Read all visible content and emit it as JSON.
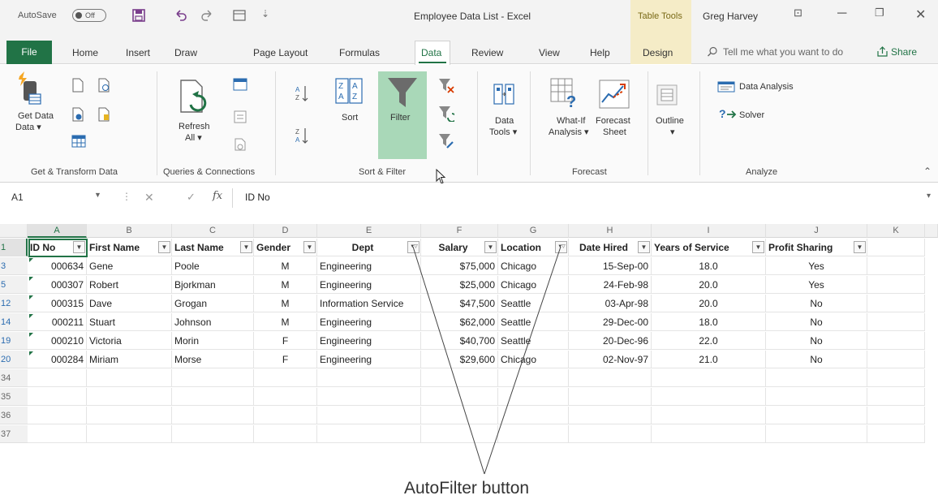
{
  "titlebar": {
    "autosave_label": "AutoSave",
    "autosave_state": "Off",
    "document_title": "Employee Data List  -  Excel",
    "context_tab_group": "Table Tools",
    "user_name": "Greg Harvey"
  },
  "tabs": [
    "File",
    "Home",
    "Insert",
    "Draw",
    "Page Layout",
    "Formulas",
    "Data",
    "Review",
    "View",
    "Help",
    "Design"
  ],
  "active_tab": "Data",
  "tell_me": "Tell me what you want to do",
  "share_label": "Share",
  "ribbon": {
    "get_data": "Get Data",
    "get_data_arrow": "Data ▾",
    "refresh": "Refresh",
    "refresh_all": "All ▾",
    "sort": "Sort",
    "filter": "Filter",
    "data_tools": "Data",
    "data_tools2": "Tools ▾",
    "what_if": "What-If",
    "what_if2": "Analysis ▾",
    "forecast": "Forecast",
    "forecast2": "Sheet",
    "outline": "Outline",
    "outline2": "▾",
    "data_analysis": "Data Analysis",
    "solver": "Solver",
    "groups": {
      "get_transform": "Get & Transform Data",
      "queries": "Queries & Connections",
      "sort_filter": "Sort & Filter",
      "forecast": "Forecast",
      "analyze": "Analyze"
    }
  },
  "formula_bar": {
    "name_box": "A1",
    "content": "ID No"
  },
  "columns": [
    "A",
    "B",
    "C",
    "D",
    "E",
    "F",
    "G",
    "H",
    "I",
    "J",
    "K"
  ],
  "header_row": {
    "row_number": "1",
    "cells": [
      "ID No",
      "First Name",
      "Last Name",
      "Gender",
      "Dept",
      "Salary",
      "Location",
      "Date Hired",
      "Years of Service",
      "Profit Sharing"
    ]
  },
  "rows": [
    {
      "row_number": "3",
      "cells": [
        "000634",
        "Gene",
        "Poole",
        "M",
        "Engineering",
        "$75,000",
        "Chicago",
        "15-Sep-00",
        "18.0",
        "Yes"
      ]
    },
    {
      "row_number": "5",
      "cells": [
        "000307",
        "Robert",
        "Bjorkman",
        "M",
        "Engineering",
        "$25,000",
        "Chicago",
        "24-Feb-98",
        "20.0",
        "Yes"
      ]
    },
    {
      "row_number": "12",
      "cells": [
        "000315",
        "Dave",
        "Grogan",
        "M",
        "Information Service",
        "$47,500",
        "Seattle",
        "03-Apr-98",
        "20.0",
        "No"
      ]
    },
    {
      "row_number": "14",
      "cells": [
        "000211",
        "Stuart",
        "Johnson",
        "M",
        "Engineering",
        "$62,000",
        "Seattle",
        "29-Dec-00",
        "18.0",
        "No"
      ]
    },
    {
      "row_number": "19",
      "cells": [
        "000210",
        "Victoria",
        "Morin",
        "F",
        "Engineering",
        "$40,700",
        "Seattle",
        "20-Dec-96",
        "22.0",
        "No"
      ]
    },
    {
      "row_number": "20",
      "cells": [
        "000284",
        "Miriam",
        "Morse",
        "F",
        "Engineering",
        "$29,600",
        "Chicago",
        "02-Nov-97",
        "21.0",
        "No"
      ]
    }
  ],
  "empty_rows": [
    "34",
    "35",
    "36",
    "37"
  ],
  "filtered_columns": [
    "Dept",
    "Location"
  ],
  "caption": "AutoFilter button",
  "colors": {
    "excel_green": "#217346",
    "filter_highlight": "#a9d8b8",
    "table_tools": "#f5ecc7"
  }
}
